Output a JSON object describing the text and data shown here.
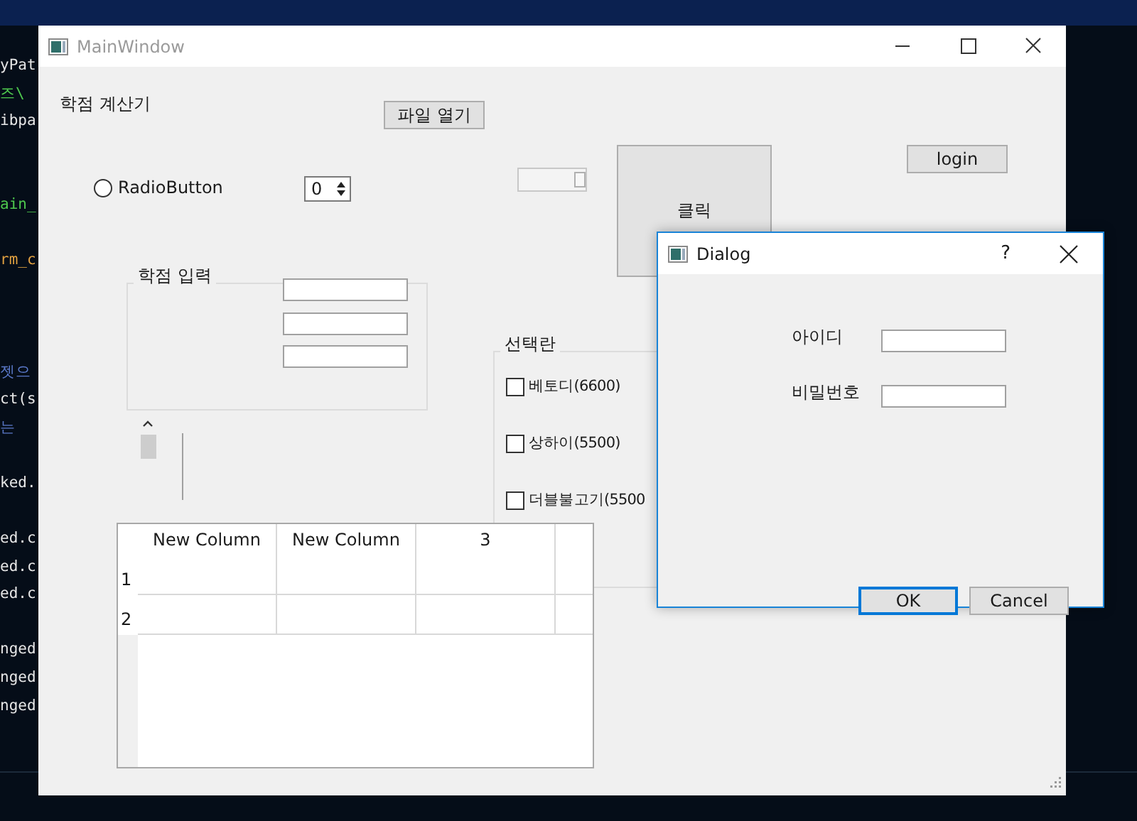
{
  "background_code": {
    "lines": [
      {
        "kind": "code",
        "text": "yPat",
        "color": "#e6e6e6"
      },
      {
        "kind": "code",
        "text": "즈\\",
        "color": "#4ec94e"
      },
      {
        "kind": "code",
        "text": "ibpa",
        "color": "#e6e6e6"
      },
      {
        "kind": "blank"
      },
      {
        "kind": "blank"
      },
      {
        "kind": "code",
        "text": "ain_",
        "color": "#4ec94e"
      },
      {
        "kind": "blank"
      },
      {
        "kind": "code",
        "text": "rm_c",
        "color": "#e0a040"
      },
      {
        "kind": "blank"
      },
      {
        "kind": "blank"
      },
      {
        "kind": "blank"
      },
      {
        "kind": "code",
        "text": "젯으",
        "color": "#5a78c8"
      },
      {
        "kind": "code",
        "text": "ct(s",
        "color": "#e6e6e6"
      },
      {
        "kind": "code",
        "text": "는",
        "color": "#5a78c8"
      },
      {
        "kind": "blank"
      },
      {
        "kind": "code",
        "text": "ked.",
        "color": "#e6e6e6"
      },
      {
        "kind": "blank"
      },
      {
        "kind": "code",
        "text": "ed.c",
        "color": "#e6e6e6"
      },
      {
        "kind": "code",
        "text": "ed.c",
        "color": "#e6e6e6"
      },
      {
        "kind": "code",
        "text": "ed.c",
        "color": "#e6e6e6"
      },
      {
        "kind": "blank"
      },
      {
        "kind": "code",
        "text": "nged",
        "color": "#e6e6e6"
      },
      {
        "kind": "code",
        "text": "nged",
        "color": "#e6e6e6"
      },
      {
        "kind": "code",
        "text": "nged",
        "color": "#e6e6e6"
      }
    ]
  },
  "main_window": {
    "title": "MainWindow",
    "heading": "학점 계산기",
    "open_button": "파일 열기",
    "radio": {
      "label": "RadioButton",
      "selected": false
    },
    "spinbox": {
      "value": "0"
    },
    "slider": {
      "level": 1
    },
    "click_button": "클릭",
    "login_button": "login",
    "grade_group": {
      "title": "학점 입력",
      "fields": [
        {
          "kind": "text"
        },
        {
          "kind": "text"
        },
        {
          "kind": "text"
        }
      ]
    },
    "menu_group": {
      "title": "선택란",
      "items": [
        {
          "label": "베토디(6600)",
          "checked": false
        },
        {
          "label": "상하이(5500)",
          "checked": false
        },
        {
          "label": "더블불고기(5500",
          "checked": false
        }
      ]
    },
    "table": {
      "columns": [
        "New Column",
        "New Column",
        "3"
      ],
      "rows": [
        {
          "header": "1"
        },
        {
          "header": "2"
        }
      ]
    }
  },
  "dialog": {
    "title": "Dialog",
    "help": "?",
    "fields": [
      {
        "label": "아이디"
      },
      {
        "label": "비밀번호"
      }
    ],
    "buttons": [
      {
        "label": "OK",
        "default": true
      },
      {
        "label": "Cancel",
        "default": false
      }
    ]
  }
}
